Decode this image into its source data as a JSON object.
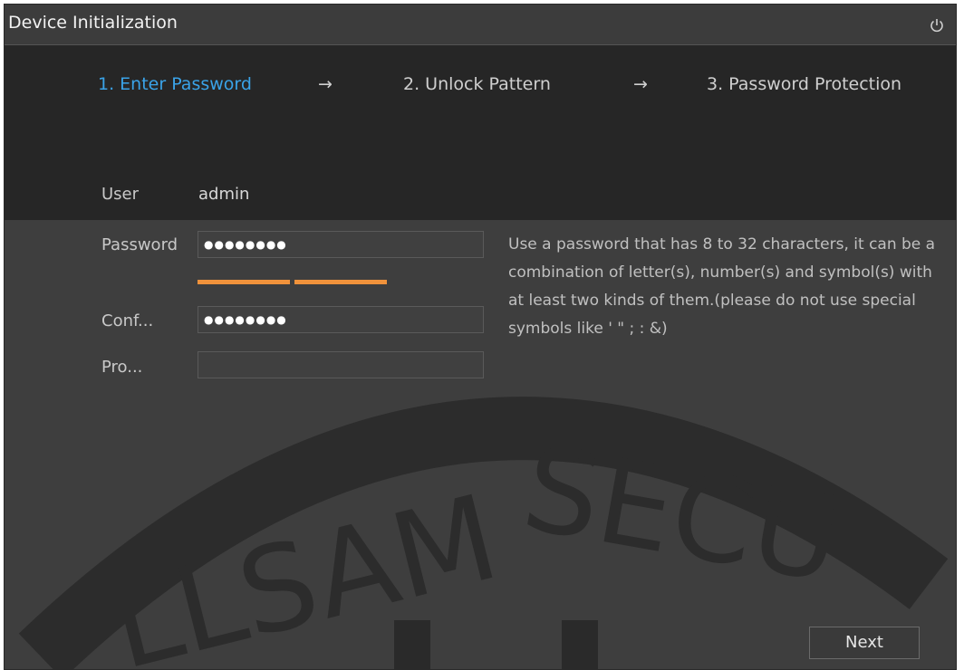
{
  "window": {
    "title": "Device Initialization"
  },
  "steps": [
    {
      "label": "1.  Enter Password",
      "active": true
    },
    {
      "label": "2.  Unlock Pattern",
      "active": false
    },
    {
      "label": "3.  Password Protection",
      "active": false
    }
  ],
  "step_arrow": "→",
  "form": {
    "user_label": "User",
    "user_value": "admin",
    "password_label": "Password",
    "password_value": "●●●●●●●●",
    "strength_segments": 2,
    "confirm_label": "Conf...",
    "confirm_value": "●●●●●●●●",
    "prompt_label": "Pro...",
    "prompt_value": ""
  },
  "hint": "Use a password that has 8 to 32 characters, it can be a combination of letter(s), number(s) and symbol(s) with at least two kinds of them.(please do not use special symbols like ' \" ; : &)",
  "watermark_text": "OLLSAM SECURITY",
  "buttons": {
    "next": "Next"
  },
  "colors": {
    "accent": "#3aa3e8",
    "strength": "#f0923b"
  },
  "icons": {
    "power": "power-icon"
  }
}
